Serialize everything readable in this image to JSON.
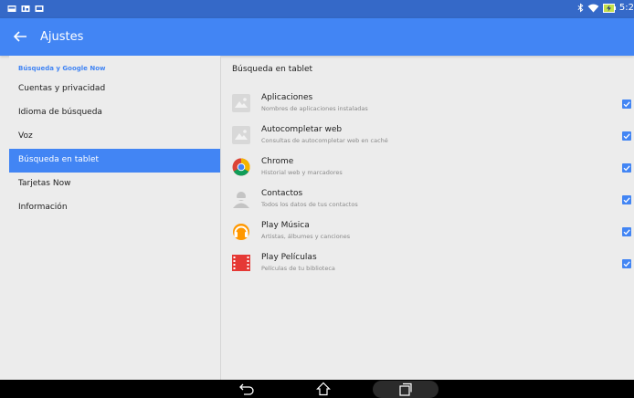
{
  "status_bar": {
    "time": "5:2",
    "notification_icons": [
      "mail-icon",
      "image-icon",
      "screen-icon"
    ],
    "system_icons": [
      "bluetooth-icon",
      "wifi-icon",
      "battery-charging-icon"
    ]
  },
  "app_bar": {
    "back_icon": "arrow-left-icon",
    "title": "Ajustes",
    "background": "#4285f4"
  },
  "sidebar": {
    "header": "Búsqueda y Google Now",
    "items": [
      {
        "label": "Cuentas y privacidad",
        "active": false
      },
      {
        "label": "Idioma de búsqueda",
        "active": false
      },
      {
        "label": "Voz",
        "active": false
      },
      {
        "label": "Búsqueda en tablet",
        "active": true
      },
      {
        "label": "Tarjetas Now",
        "active": false
      },
      {
        "label": "Información",
        "active": false
      }
    ]
  },
  "main": {
    "title": "Búsqueda en tablet",
    "apps": [
      {
        "name": "Aplicaciones",
        "description": "Nombres de aplicaciones instaladas",
        "icon": "generic-app-icon",
        "checked": true
      },
      {
        "name": "Autocompletar web",
        "description": "Consultas de autocompletar web en caché",
        "icon": "generic-app-icon",
        "checked": true
      },
      {
        "name": "Chrome",
        "description": "Historial web y marcadores",
        "icon": "chrome-icon",
        "checked": true
      },
      {
        "name": "Contactos",
        "description": "Todos los datos de tus contactos",
        "icon": "contacts-icon",
        "checked": true
      },
      {
        "name": "Play Música",
        "description": "Artistas, álbumes y canciones",
        "icon": "play-music-icon",
        "checked": true
      },
      {
        "name": "Play Películas",
        "description": "Películas de tu biblioteca",
        "icon": "play-movies-icon",
        "checked": true
      }
    ]
  },
  "nav_bar": {
    "buttons": [
      "back-icon",
      "home-icon",
      "recents-icon"
    ]
  }
}
